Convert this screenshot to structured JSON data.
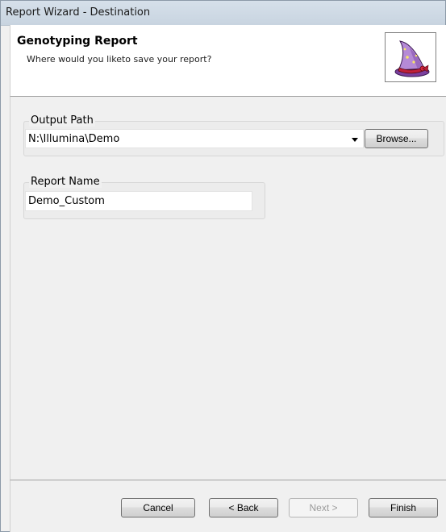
{
  "window": {
    "title": "Report Wizard - Destination"
  },
  "header": {
    "title": "Genotyping Report",
    "subtitle": "Where would you liketo save your report?",
    "icon": "wizard-hat-icon"
  },
  "output_path": {
    "label": "Output Path",
    "value": "N:\\Illumina\\Demo",
    "browse_label": "Browse..."
  },
  "report_name": {
    "label": "Report Name",
    "value": "Demo_Custom"
  },
  "footer": {
    "cancel_label": "Cancel",
    "back_label": "< Back",
    "next_label": "Next >",
    "finish_label": "Finish"
  }
}
